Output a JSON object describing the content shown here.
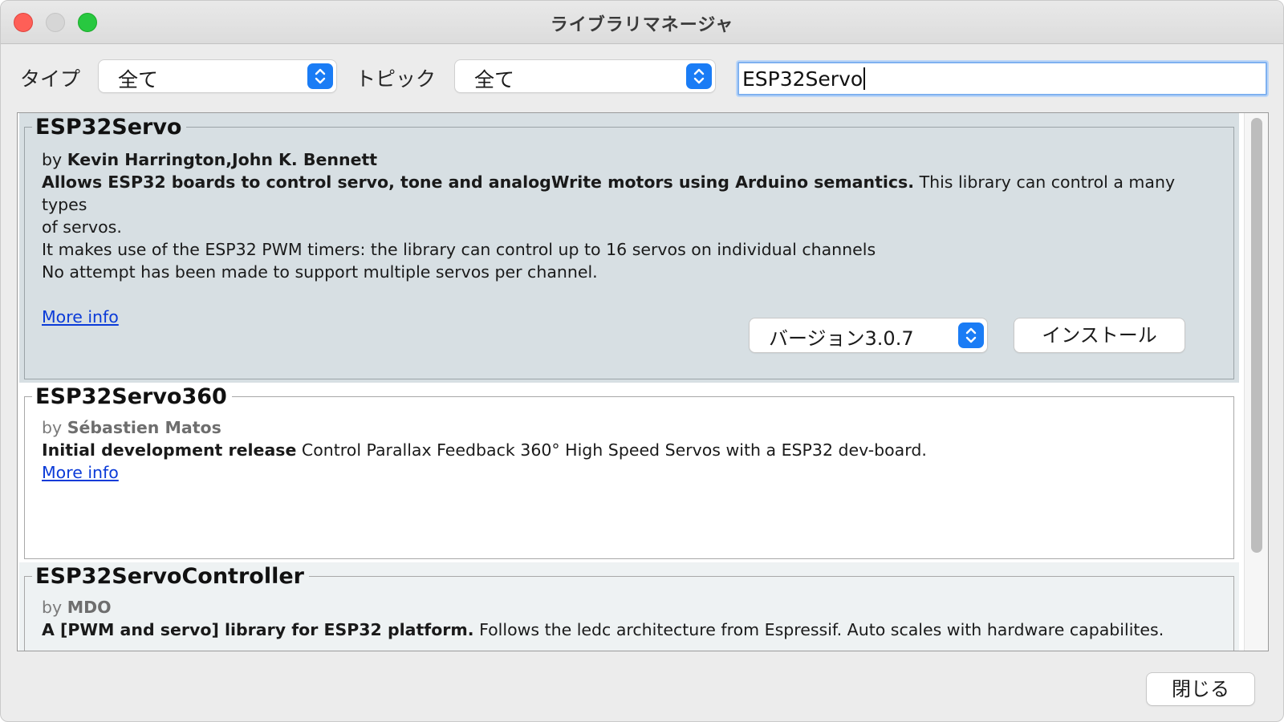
{
  "window": {
    "title": "ライブラリマネージャ"
  },
  "filters": {
    "type_label": "タイプ",
    "type_value": "全て",
    "topic_label": "トピック",
    "topic_value": "全て"
  },
  "search": {
    "value": "ESP32Servo"
  },
  "libraries": [
    {
      "name": "ESP32Servo",
      "by_prefix": "by",
      "author": "Kevin Harrington,John K. Bennett",
      "sentence": "Allows ESP32 boards to control servo, tone and analogWrite motors using Arduino semantics.",
      "paragraph_line1": "This library can control a many types",
      "paragraph_line2": "of servos.",
      "paragraph_line3": "It makes use of the ESP32 PWM timers: the library can control up to 16 servos on individual channels",
      "paragraph_line4": "No attempt has been made to support multiple servos per channel.",
      "more_info": "More info",
      "version_label": "バージョン3.0.7",
      "install_label": "インストール"
    },
    {
      "name": "ESP32Servo360",
      "by_prefix": "by",
      "author": "Sébastien Matos",
      "sentence": "Initial development release",
      "paragraph": "Control Parallax Feedback 360° High Speed Servos with a ESP32 dev-board.",
      "more_info": "More info"
    },
    {
      "name": "ESP32ServoController",
      "by_prefix": "by",
      "author": "MDO",
      "sentence": "A [PWM and servo] library for ESP32 platform.",
      "paragraph": "Follows the ledc architecture from Espressif. Auto scales with hardware capabilites."
    }
  ],
  "footer": {
    "close_label": "閉じる"
  },
  "colors": {
    "accent": "#1a7cf5",
    "link": "#0b3bd8",
    "selected_bg": "#d7dfe3"
  },
  "icons": [
    "updown-chevron-icon"
  ]
}
